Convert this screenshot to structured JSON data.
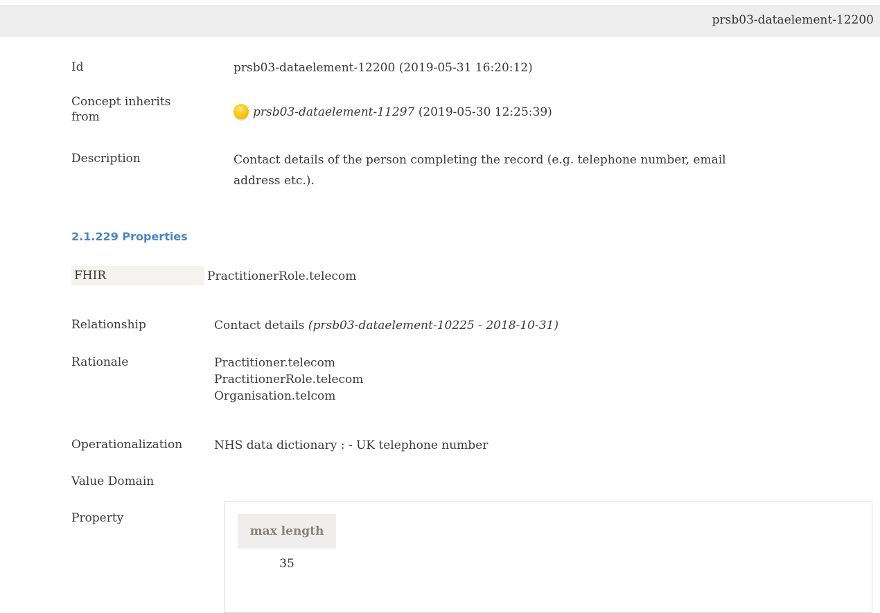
{
  "header": {
    "title": "prsb03-dataelement-12200"
  },
  "fields": {
    "id": {
      "label": "Id",
      "value": "prsb03-dataelement-12200 (2019-05-31 16:20:12)"
    },
    "inherits": {
      "label_line1": "Concept inherits",
      "label_line2": "from",
      "link": "prsb03-dataelement-11297",
      "date": "(2019-05-30 12:25:39)",
      "status_color": "#ffc400"
    },
    "description": {
      "label": "Description",
      "line1": "Contact details of the person completing the record (e.g. telephone number, email",
      "line2": "address etc.)."
    }
  },
  "properties_section": {
    "heading": "2.1.229 Properties"
  },
  "properties": {
    "fhir": {
      "label": "FHIR",
      "value": "PractitionerRole.telecom"
    },
    "relationship": {
      "label": "Relationship",
      "value": "Contact details",
      "ref": "(prsb03-dataelement-10225 - 2018-10-31)"
    },
    "rationale": {
      "label": "Rationale",
      "lines": [
        "Practitioner.telecom",
        "PractitionerRole.telecom",
        "Organisation.telcom"
      ]
    },
    "operationalization": {
      "label": "Operationalization",
      "value": "NHS data dictionary : - UK telephone number"
    },
    "value_domain": {
      "label": "Value Domain"
    },
    "property": {
      "label": "Property",
      "column_header": "max length",
      "column_value": "35"
    }
  }
}
